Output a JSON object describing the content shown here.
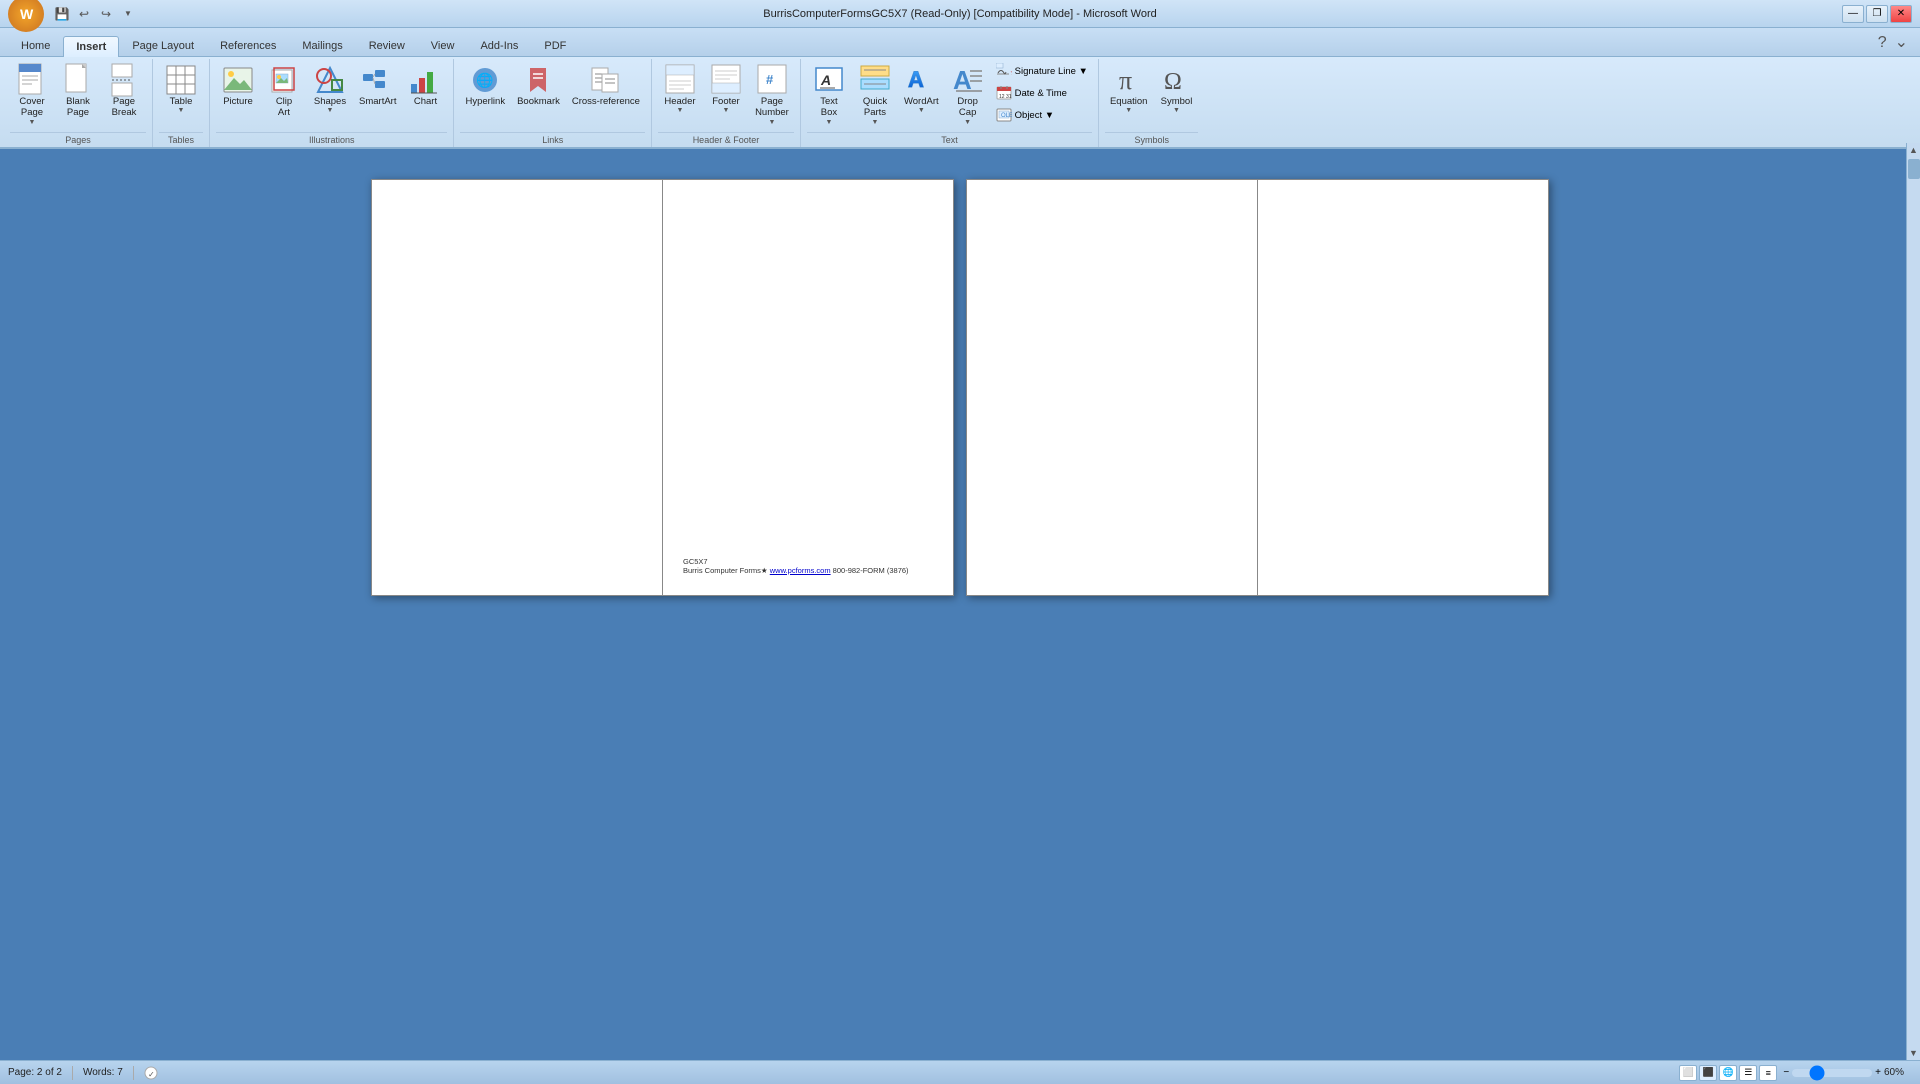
{
  "titlebar": {
    "title": "BurrisComputerFormsGC5X7 (Read-Only) [Compatibility Mode] - Microsoft Word",
    "minimize": "—",
    "restore": "❐",
    "close": "✕"
  },
  "quickaccess": {
    "save": "💾",
    "undo": "↩",
    "redo": "↪"
  },
  "tabs": [
    {
      "label": "Home",
      "active": false
    },
    {
      "label": "Insert",
      "active": true
    },
    {
      "label": "Page Layout",
      "active": false
    },
    {
      "label": "References",
      "active": false
    },
    {
      "label": "Mailings",
      "active": false
    },
    {
      "label": "Review",
      "active": false
    },
    {
      "label": "View",
      "active": false
    },
    {
      "label": "Add-Ins",
      "active": false
    },
    {
      "label": "PDF",
      "active": false
    }
  ],
  "ribbon": {
    "groups": [
      {
        "label": "Pages",
        "items": [
          {
            "id": "cover-page",
            "icon": "📄",
            "label": "Cover\nPage",
            "hasDropdown": true
          },
          {
            "id": "blank-page",
            "icon": "📋",
            "label": "Blank\nPage",
            "hasDropdown": false
          },
          {
            "id": "page-break",
            "icon": "📃",
            "label": "Page\nBreak",
            "hasDropdown": false
          }
        ]
      },
      {
        "label": "Tables",
        "items": [
          {
            "id": "table",
            "icon": "⊞",
            "label": "Table",
            "hasDropdown": true
          }
        ]
      },
      {
        "label": "Illustrations",
        "items": [
          {
            "id": "picture",
            "icon": "🖼",
            "label": "Picture",
            "hasDropdown": false
          },
          {
            "id": "clip-art",
            "icon": "✂",
            "label": "Clip\nArt",
            "hasDropdown": false
          },
          {
            "id": "shapes",
            "icon": "⬟",
            "label": "Shapes",
            "hasDropdown": true
          },
          {
            "id": "smartart",
            "icon": "🔷",
            "label": "SmartArt",
            "hasDropdown": false
          },
          {
            "id": "chart",
            "icon": "📊",
            "label": "Chart",
            "hasDropdown": false
          }
        ]
      },
      {
        "label": "Links",
        "items": [
          {
            "id": "hyperlink",
            "icon": "🌐",
            "label": "Hyperlink",
            "hasDropdown": false
          },
          {
            "id": "bookmark",
            "icon": "🔖",
            "label": "Bookmark",
            "hasDropdown": false
          },
          {
            "id": "cross-reference",
            "icon": "📑",
            "label": "Cross-reference",
            "hasDropdown": false
          }
        ]
      },
      {
        "label": "Header & Footer",
        "items": [
          {
            "id": "header",
            "icon": "⬆",
            "label": "Header",
            "hasDropdown": true
          },
          {
            "id": "footer",
            "icon": "⬇",
            "label": "Footer",
            "hasDropdown": true
          },
          {
            "id": "page-number",
            "icon": "#",
            "label": "Page\nNumber",
            "hasDropdown": true
          }
        ]
      },
      {
        "label": "Text",
        "items": [
          {
            "id": "text-box",
            "icon": "▭",
            "label": "Text\nBox",
            "hasDropdown": true
          },
          {
            "id": "quick-parts",
            "icon": "⚡",
            "label": "Quick\nParts",
            "hasDropdown": true
          },
          {
            "id": "wordart",
            "icon": "A",
            "label": "WordArt",
            "hasDropdown": true
          },
          {
            "id": "drop-cap",
            "icon": "A",
            "label": "Drop\nCap",
            "hasDropdown": true
          },
          {
            "id": "signature-line",
            "icon": "✍",
            "label": "Signature Line",
            "hasDropdown": true
          },
          {
            "id": "date-time",
            "icon": "📅",
            "label": "Date & Time",
            "hasDropdown": false
          },
          {
            "id": "object",
            "icon": "📦",
            "label": "Object",
            "hasDropdown": true
          }
        ]
      },
      {
        "label": "Symbols",
        "items": [
          {
            "id": "equation",
            "icon": "π",
            "label": "Equation",
            "hasDropdown": true
          },
          {
            "id": "symbol",
            "icon": "Ω",
            "label": "Symbol",
            "hasDropdown": true
          }
        ]
      }
    ]
  },
  "page1": {
    "footer_line1": "GC5X7",
    "footer_line2": "Burris Computer Forms★ ",
    "footer_link": "www.pcforms.com",
    "footer_after_link": " 800-982-FORM (3876)"
  },
  "statusbar": {
    "page": "Page: 2 of 2",
    "words": "Words: 7",
    "zoom_label": "60%"
  }
}
